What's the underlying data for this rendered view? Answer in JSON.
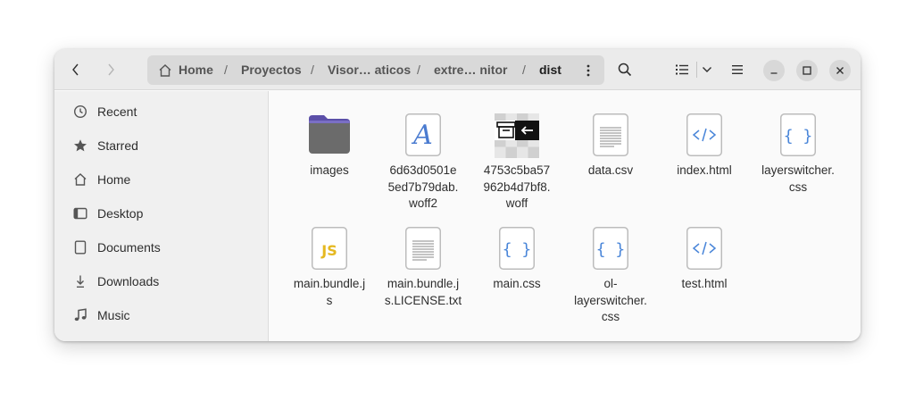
{
  "header": {
    "back_icon": "chevron-left-icon",
    "forward_icon": "chevron-right-icon",
    "path": [
      {
        "label": "Home",
        "icon": "home-icon"
      },
      {
        "label": "Proyectos"
      },
      {
        "label": "Visor… aticos"
      },
      {
        "label": "extre… nitor"
      },
      {
        "label": "dist"
      }
    ],
    "separator": "/",
    "path_menu_icon": "vertical-dots-icon",
    "search_icon": "search-icon",
    "view_icon": "list-view-icon",
    "view_dropdown_icon": "chevron-down-icon",
    "main_menu_icon": "hamburger-menu-icon",
    "minimize_icon": "minimize-icon",
    "maximize_icon": "maximize-icon",
    "close_icon": "close-icon"
  },
  "sidebar": {
    "items": [
      {
        "label": "Recent",
        "icon": "clock-icon"
      },
      {
        "label": "Starred",
        "icon": "star-icon"
      },
      {
        "label": "Home",
        "icon": "home-icon"
      },
      {
        "label": "Desktop",
        "icon": "desktop-icon"
      },
      {
        "label": "Documents",
        "icon": "document-icon"
      },
      {
        "label": "Downloads",
        "icon": "download-icon"
      },
      {
        "label": "Music",
        "icon": "music-icon"
      }
    ]
  },
  "files": [
    {
      "name": "images",
      "type": "folder"
    },
    {
      "name": "6d63d0501e\n5ed7b79dab.\nwoff2",
      "type": "font"
    },
    {
      "name": "4753c5ba57\n962b4d7bf8.\nwoff",
      "type": "archive-thumbnail"
    },
    {
      "name": "data.csv",
      "type": "text"
    },
    {
      "name": "index.html",
      "type": "html"
    },
    {
      "name": "layerswitcher.\ncss",
      "type": "css"
    },
    {
      "name": "main.bundle.j\ns",
      "type": "js"
    },
    {
      "name": "main.bundle.j\ns.LICENSE.txt",
      "type": "text"
    },
    {
      "name": "main.css",
      "type": "css"
    },
    {
      "name": "ol-\nlayerswitcher.\ncss",
      "type": "css"
    },
    {
      "name": "test.html",
      "type": "html"
    }
  ],
  "colors": {
    "folder": "#6b6b6b",
    "folder_tab": "#5b4fa8",
    "code_blue": "#4a86d9",
    "js_yellow": "#e5b820",
    "font_blue": "#4a7bd0"
  }
}
